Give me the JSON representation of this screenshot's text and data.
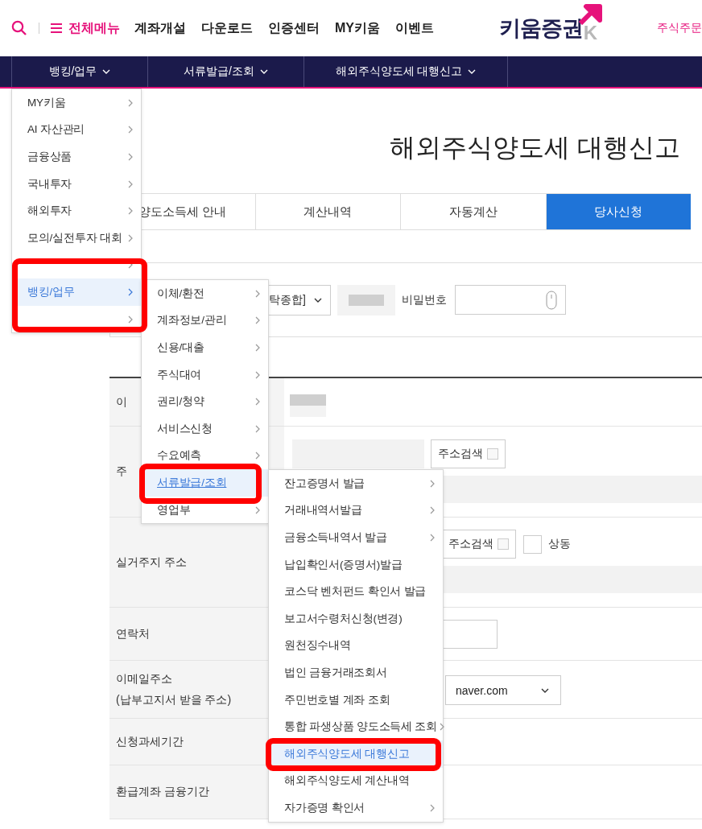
{
  "header": {
    "menu_button": "전체메뉴",
    "links": [
      "계좌개설",
      "다운로드",
      "인증센터",
      "MY키움",
      "이벤트"
    ],
    "logo": "키움증권",
    "logo_mark": "K",
    "order_link": "주식주문"
  },
  "nav": [
    {
      "label": "뱅킹/업무"
    },
    {
      "label": "서류발급/조회"
    },
    {
      "label": "해외주식양도세 대행신고"
    }
  ],
  "page_title": "해외주식양도세 대행신고",
  "tabs": [
    {
      "label": "양도소득세 안내",
      "selected": false
    },
    {
      "label": "계산내역",
      "selected": false
    },
    {
      "label": "자동계산",
      "selected": false
    },
    {
      "label": "당사신청",
      "selected": true
    }
  ],
  "account": {
    "account_select": "탁종합]",
    "password_label": "비밀번호"
  },
  "form_rows": [
    {
      "label": "이",
      "kind": "name"
    },
    {
      "label": "주",
      "kind": "address",
      "search_button": "주소검색"
    },
    {
      "label": "실거주지 주소",
      "kind": "residence",
      "search_button": "주소검색",
      "same_label": "상동",
      "same_checked": false
    },
    {
      "label": "연락처",
      "kind": "phone"
    },
    {
      "label": "이메일주소",
      "sublabel": "(납부고지서 받을 주소)",
      "kind": "email",
      "domain": "naver.com"
    },
    {
      "label": "신청과세기간",
      "kind": "empty"
    },
    {
      "label": "환급계좌 금융기간",
      "kind": "empty"
    }
  ],
  "menus": [
    {
      "items": [
        {
          "label": "MY키움",
          "submenu": true,
          "selected": false
        },
        {
          "label": "AI 자산관리",
          "submenu": true,
          "selected": false
        },
        {
          "label": "금융상품",
          "submenu": true,
          "selected": false
        },
        {
          "label": "국내투자",
          "submenu": true,
          "selected": false
        },
        {
          "label": "해외투자",
          "submenu": true,
          "selected": false
        },
        {
          "label": "모의/실전투자 대회",
          "submenu": true,
          "selected": false
        },
        {
          "submenu": true
        },
        {
          "label": "뱅킹/업무",
          "submenu": true,
          "selected": true,
          "highlighted": true
        },
        {
          "submenu": true
        }
      ]
    },
    {
      "items": [
        {
          "label": "이체/환전",
          "submenu": true,
          "selected": false
        },
        {
          "label": "계좌정보/관리",
          "submenu": true,
          "selected": false
        },
        {
          "label": "신용/대출",
          "submenu": true,
          "selected": false
        },
        {
          "label": "주식대여",
          "submenu": true,
          "selected": false
        },
        {
          "label": "권리/청약",
          "submenu": true,
          "selected": false
        },
        {
          "label": "서비스신청",
          "submenu": true,
          "selected": false
        },
        {
          "label": "수요예측",
          "submenu": true,
          "selected": false
        },
        {
          "label": "서류발급/조회",
          "submenu": false,
          "selected": true,
          "underlined": true,
          "highlighted": true
        },
        {
          "label": "영업부",
          "submenu": true,
          "selected": false
        }
      ]
    },
    {
      "items": [
        {
          "label": "잔고증명서 발급",
          "submenu": true,
          "selected": false
        },
        {
          "label": "거래내역서발급",
          "submenu": true,
          "selected": false
        },
        {
          "label": "금융소득내역서 발급",
          "submenu": true,
          "selected": false
        },
        {
          "label": "납입확인서(증명서)발급",
          "submenu": false,
          "selected": false
        },
        {
          "label": "코스닥 벤처펀드 확인서 발급",
          "submenu": false,
          "selected": false
        },
        {
          "label": "보고서수령처신청(변경)",
          "submenu": false,
          "selected": false
        },
        {
          "label": "원천징수내역",
          "submenu": false,
          "selected": false
        },
        {
          "label": "법인 금융거래조회서",
          "submenu": false,
          "selected": false
        },
        {
          "label": "주민번호별 계좌 조회",
          "submenu": false,
          "selected": false
        },
        {
          "label": "통합 파생상품 양도소득세 조회",
          "submenu": true,
          "selected": false
        },
        {
          "label": "해외주식양도세 대행신고",
          "submenu": false,
          "selected": true,
          "highlighted": true
        },
        {
          "label": "해외주식양도세 계산내역",
          "submenu": false,
          "selected": false
        },
        {
          "label": "자가증명 확인서",
          "submenu": true,
          "selected": false
        }
      ]
    }
  ]
}
